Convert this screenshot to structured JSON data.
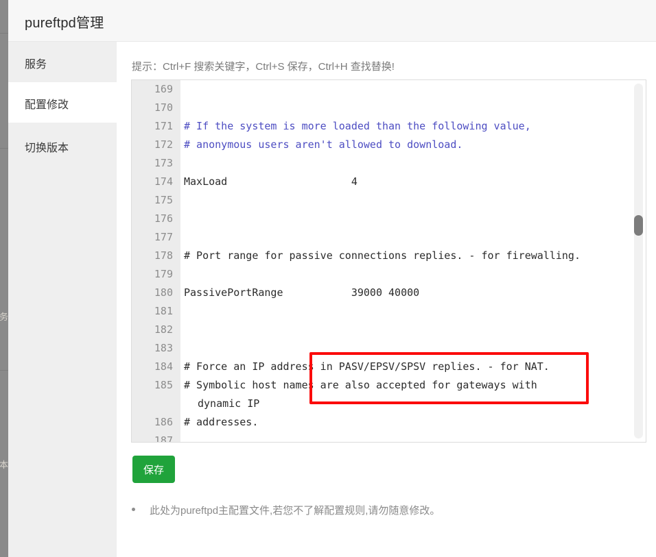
{
  "header": {
    "title": "pureftpd管理"
  },
  "sidebar": {
    "items": [
      {
        "label": "服务",
        "active": false
      },
      {
        "label": "配置修改",
        "active": true
      },
      {
        "label": "切换版本",
        "active": false
      }
    ]
  },
  "left_rail": {
    "clipped_labels": [
      "务",
      "本"
    ]
  },
  "main": {
    "hint": "提示：Ctrl+F 搜索关键字，Ctrl+S 保存，Ctrl+H 查找替换!",
    "save_label": "保存",
    "note": "此处为pureftpd主配置文件,若您不了解配置规则,请勿随意修改。"
  },
  "editor": {
    "scroll_thumb_position_pct": 37,
    "lines": [
      {
        "num": "169",
        "text": "",
        "style": "plain"
      },
      {
        "num": "170",
        "text": "",
        "style": "plain"
      },
      {
        "num": "171",
        "text": "# If the system is more loaded than the following value,",
        "style": "comment-blue"
      },
      {
        "num": "172",
        "text": "# anonymous users aren't allowed to download.",
        "style": "comment-blue"
      },
      {
        "num": "173",
        "text": "",
        "style": "plain"
      },
      {
        "num": "174",
        "text": "MaxLoad                    4",
        "style": "plain"
      },
      {
        "num": "175",
        "text": "",
        "style": "plain"
      },
      {
        "num": "176",
        "text": "",
        "style": "plain"
      },
      {
        "num": "177",
        "text": "",
        "style": "plain"
      },
      {
        "num": "178",
        "text": "# Port range for passive connections replies. - for firewalling.",
        "style": "plain"
      },
      {
        "num": "179",
        "text": "",
        "style": "plain"
      },
      {
        "num": "180",
        "text": "PassivePortRange           39000 40000",
        "style": "plain"
      },
      {
        "num": "181",
        "text": "",
        "style": "plain"
      },
      {
        "num": "182",
        "text": "",
        "style": "plain"
      },
      {
        "num": "183",
        "text": "",
        "style": "plain"
      },
      {
        "num": "184",
        "text": "# Force an IP address in PASV/EPSV/SPSV replies. - for NAT.",
        "style": "plain"
      },
      {
        "num": "185",
        "text": "# Symbolic host names are also accepted for gateways with",
        "style": "plain"
      },
      {
        "num": "",
        "text": "dynamic IP",
        "style": "wrap"
      },
      {
        "num": "186",
        "text": "# addresses.",
        "style": "plain"
      },
      {
        "num": "187",
        "text": "",
        "style": "plain"
      }
    ],
    "highlight": {
      "annotation_color": "#fb0b0b",
      "target_line": "180",
      "target_text": "PassivePortRange           39000 40000"
    }
  },
  "colors": {
    "accent_green": "#20a33b",
    "annotation_red": "#fb0b0b",
    "comment_blue": "#4d4dc2",
    "sidebar_bg": "#efefef",
    "header_bg": "#f7f7f7"
  }
}
